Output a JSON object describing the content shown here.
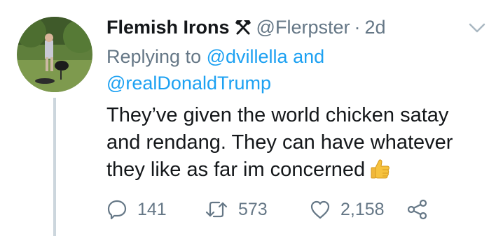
{
  "author": {
    "name": "Flemish Irons",
    "badge_icon": "crossed-hammers-icon",
    "handle": "@Flerpster",
    "separator": "·",
    "time": "2d",
    "avatar_icon": "avatar-photo-grill"
  },
  "replying": {
    "prefix": "Replying to",
    "mention_1": "@dvillella",
    "conjunction": "and",
    "mention_2": "@realDonaldTrump"
  },
  "tweet": {
    "line_1": "They’ve given the world chicken satay",
    "line_2": "and rendang. They can have whatever",
    "line_3": "they like as far im concerned",
    "emoji_icon": "thumbs-up-icon"
  },
  "actions": {
    "reply_count": "141",
    "retweet_count": "573",
    "like_count": "2,158"
  },
  "colors": {
    "text": "#14171a",
    "muted": "#657786",
    "link": "#1da1f2",
    "thread": "#ccd6dd"
  }
}
